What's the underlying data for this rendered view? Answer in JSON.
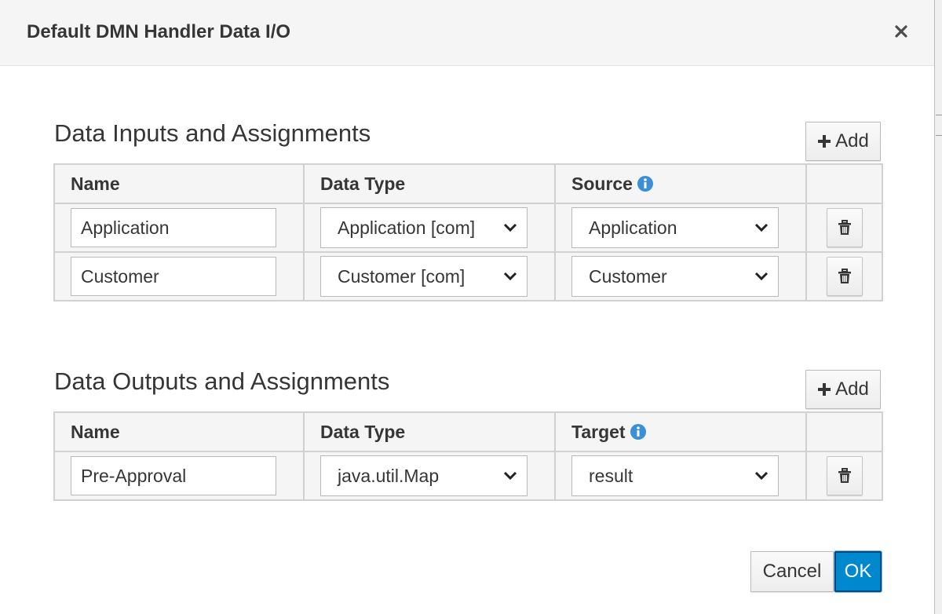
{
  "dialog": {
    "title": "Default DMN Handler Data I/O",
    "close_icon": "close-icon"
  },
  "inputs": {
    "section_title": "Data Inputs and Assignments",
    "add_label": "Add",
    "columns": {
      "name": "Name",
      "data_type": "Data Type",
      "source": "Source"
    },
    "rows": [
      {
        "name": "Application",
        "data_type": "Application [com]",
        "source": "Application"
      },
      {
        "name": "Customer",
        "data_type": "Customer [com]",
        "source": "Customer"
      }
    ]
  },
  "outputs": {
    "section_title": "Data Outputs and Assignments",
    "add_label": "Add",
    "columns": {
      "name": "Name",
      "data_type": "Data Type",
      "target": "Target"
    },
    "rows": [
      {
        "name": "Pre-Approval",
        "data_type": "java.util.Map",
        "target": "result"
      }
    ]
  },
  "footer": {
    "cancel_label": "Cancel",
    "ok_label": "OK"
  },
  "colors": {
    "accent": "#0088ce",
    "info_icon": "#3a8fd6",
    "header_bg": "#f5f5f5"
  }
}
